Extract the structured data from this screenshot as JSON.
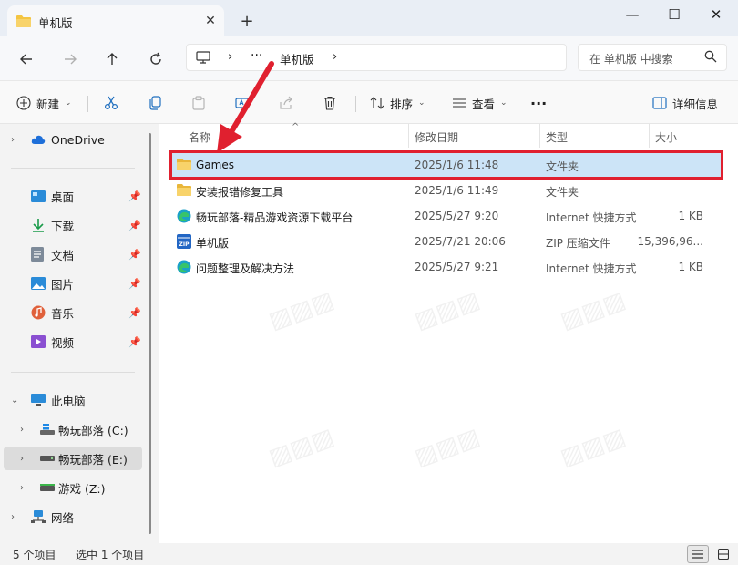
{
  "window": {
    "tab_title": "单机版",
    "tab_close": "✕",
    "new_tab": "+",
    "minimize": "—",
    "maximize": "☐",
    "close": "✕"
  },
  "address": {
    "more": "···",
    "separator": "›",
    "breadcrumb": "单机版",
    "search_placeholder": "在 单机版 中搜索"
  },
  "command_bar": {
    "new_label": "新建",
    "sort_label": "排序",
    "view_label": "查看",
    "more": "···",
    "details_label": "详细信息"
  },
  "sidebar": {
    "onedrive": "OneDrive",
    "quick": [
      {
        "label": "桌面",
        "icon": "desktop-icon"
      },
      {
        "label": "下载",
        "icon": "download-icon"
      },
      {
        "label": "文档",
        "icon": "documents-icon"
      },
      {
        "label": "图片",
        "icon": "pictures-icon"
      },
      {
        "label": "音乐",
        "icon": "music-icon"
      },
      {
        "label": "视频",
        "icon": "videos-icon"
      }
    ],
    "this_pc": "此电脑",
    "drives": [
      {
        "label": "畅玩部落 (C:)",
        "icon": "windows-drive-icon"
      },
      {
        "label": "畅玩部落 (E:)",
        "icon": "drive-icon"
      },
      {
        "label": "游戏 (Z:)",
        "icon": "drive-icon"
      }
    ],
    "network": "网络"
  },
  "columns": {
    "name": "名称",
    "modified": "修改日期",
    "type": "类型",
    "size": "大小"
  },
  "files": [
    {
      "name": "Games",
      "modified": "2025/1/6 11:48",
      "type": "文件夹",
      "size": "",
      "icon": "folder-icon"
    },
    {
      "name": "安装报错修复工具",
      "modified": "2025/1/6 11:49",
      "type": "文件夹",
      "size": "",
      "icon": "folder-icon"
    },
    {
      "name": "畅玩部落-精品游戏资源下载平台",
      "modified": "2025/5/27 9:20",
      "type": "Internet 快捷方式",
      "size": "1 KB",
      "icon": "edge-shortcut-icon"
    },
    {
      "name": "单机版",
      "modified": "2025/7/21 20:06",
      "type": "ZIP 压缩文件",
      "size": "15,396,96...",
      "icon": "zip-icon"
    },
    {
      "name": "问题整理及解决方法",
      "modified": "2025/5/27 9:21",
      "type": "Internet 快捷方式",
      "size": "1 KB",
      "icon": "edge-shortcut-icon"
    }
  ],
  "status": {
    "count": "5 个项目",
    "selected": "选中 1 个项目"
  },
  "colors": {
    "selection": "#cce4f7",
    "highlight_outline": "#e0202f",
    "folder": "#f4c542"
  }
}
